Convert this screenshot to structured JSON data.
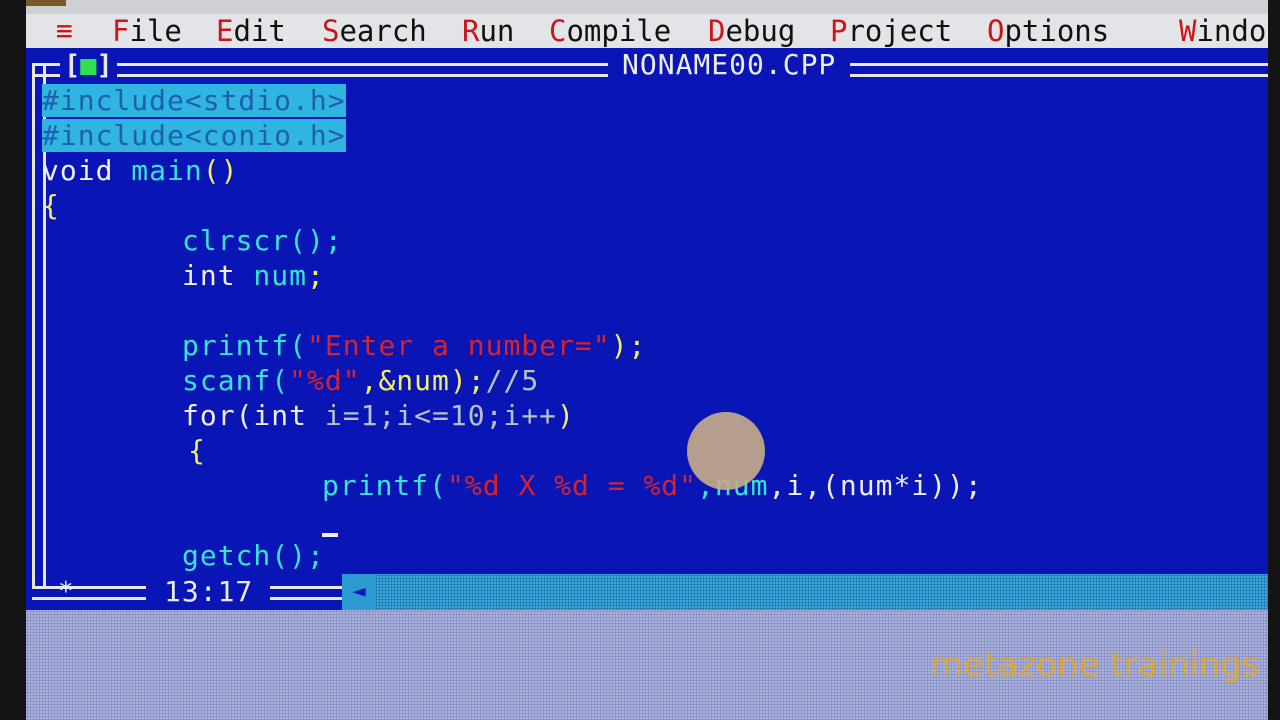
{
  "menu": {
    "system": "≡",
    "items": [
      {
        "hotkey": "F",
        "rest": "ile"
      },
      {
        "hotkey": "E",
        "rest": "dit"
      },
      {
        "hotkey": "S",
        "rest": "earch"
      },
      {
        "hotkey": "R",
        "rest": "un"
      },
      {
        "hotkey": "C",
        "rest": "ompile"
      },
      {
        "hotkey": "D",
        "rest": "ebug"
      },
      {
        "hotkey": "P",
        "rest": "roject"
      },
      {
        "hotkey": "O",
        "rest": "ptions"
      },
      {
        "hotkey": "W",
        "rest": "indo"
      }
    ]
  },
  "window": {
    "close_left": "[",
    "close_mark": "■",
    "close_right": "]",
    "title": "NONAME00.CPP"
  },
  "code": {
    "l1": "#include<stdio.h>",
    "l2": "#include<conio.h>",
    "l3_a": "void",
    "l3_b": " main",
    "l3_c": "()",
    "l4": "{",
    "l5": "clrscr();",
    "l6_a": "int",
    "l6_b": " num",
    "l6_c": ";",
    "l7_a": "printf(",
    "l7_b": "\"Enter a number=\"",
    "l7_c": ");",
    "l8_a": "scanf(",
    "l8_b": "\"%d\"",
    "l8_c": ",&num);",
    "l8_d": "//5",
    "l9_a": "for(int ",
    "l9_b": "i=1;i<=10;i++",
    "l9_c": ")",
    "l10": "{",
    "l11_a": "printf(",
    "l11_b": "\"%d X %d = %d\"",
    "l11_c": ",num",
    "l11_d": ",i,(num*i));",
    "l12": "getch();"
  },
  "status": {
    "marker": "*",
    "position": "13:17",
    "scroll_arrow": "◄"
  },
  "watermark": "metazone trainings"
}
